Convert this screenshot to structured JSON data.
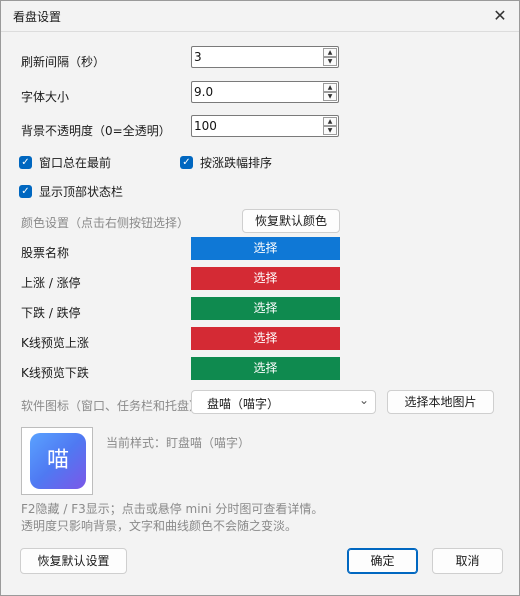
{
  "window": {
    "title": "看盘设置"
  },
  "settings": {
    "refresh_label": "刷新间隔（秒）",
    "refresh_value": "3",
    "font_label": "字体大小",
    "font_value": "9.0",
    "opacity_label": "背景不透明度（0=全透明）",
    "opacity_value": "100"
  },
  "options": {
    "always_on_top": "窗口总在最前",
    "sort_by_change": "按涨跌幅排序",
    "show_top_status": "显示顶部状态栏"
  },
  "colors": {
    "section_label": "颜色设置（点击右侧按钮选择）",
    "reset_button": "恢复默认颜色",
    "choose_label": "选择",
    "rows": [
      {
        "label": "股票名称",
        "color": "#0f78d6"
      },
      {
        "label": "上涨 / 涨停",
        "color": "#d42a34"
      },
      {
        "label": "下跌 / 跌停",
        "color": "#0f8a4f"
      },
      {
        "label": "K线预览上涨",
        "color": "#d42a34"
      },
      {
        "label": "K线预览下跌",
        "color": "#0f8a4f"
      }
    ]
  },
  "software_icon": {
    "label": "软件图标（窗口、任务栏和托盘）",
    "selected": "盘喵（喵字）",
    "choose_local": "选择本地图片",
    "current_style": "当前样式：盯盘喵（喵字）",
    "icon_char": "喵"
  },
  "hints": {
    "line1": "F2隐藏 / F3显示；点击或悬停 mini 分时图可查看详情。",
    "line2": "透明度只影响背景，文字和曲线颜色不会随之变淡。"
  },
  "footer": {
    "reset_all": "恢复默认设置",
    "ok": "确定",
    "cancel": "取消"
  }
}
